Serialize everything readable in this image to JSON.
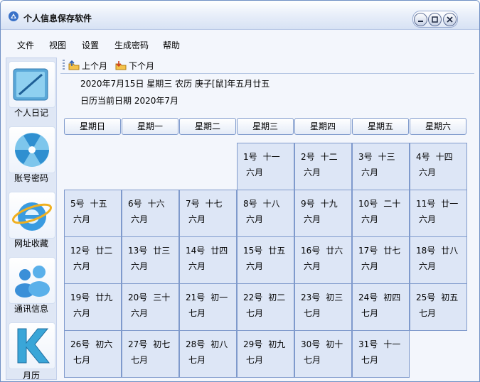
{
  "window": {
    "title": "个人信息保存软件"
  },
  "menu": [
    "文件",
    "视图",
    "设置",
    "生成密码",
    "帮助"
  ],
  "sidebar": [
    {
      "label": "个人日记",
      "icon": "diary-icon"
    },
    {
      "label": "账号密码",
      "icon": "account-password-icon"
    },
    {
      "label": "网址收藏",
      "icon": "ie-bookmark-icon"
    },
    {
      "label": "通讯信息",
      "icon": "contacts-icon"
    },
    {
      "label": "月历",
      "icon": "calendar-icon"
    }
  ],
  "toolbar": {
    "prev_label": "上个月",
    "next_label": "下个月"
  },
  "info": {
    "today": "2020年7月15日  星期三  农历  庚子[鼠]年五月廿五",
    "current": "日历当前日期  2020年7月"
  },
  "weekdays": [
    "星期日",
    "星期一",
    "星期二",
    "星期三",
    "星期四",
    "星期五",
    "星期六"
  ],
  "days": [
    {
      "day": "1号",
      "lunar": "十一",
      "month": "六月"
    },
    {
      "day": "2号",
      "lunar": "十二",
      "month": "六月"
    },
    {
      "day": "3号",
      "lunar": "十三",
      "month": "六月"
    },
    {
      "day": "4号",
      "lunar": "十四",
      "month": "六月"
    },
    {
      "day": "5号",
      "lunar": "十五",
      "month": "六月"
    },
    {
      "day": "6号",
      "lunar": "十六",
      "month": "六月"
    },
    {
      "day": "7号",
      "lunar": "十七",
      "month": "六月"
    },
    {
      "day": "8号",
      "lunar": "十八",
      "month": "六月"
    },
    {
      "day": "9号",
      "lunar": "十九",
      "month": "六月"
    },
    {
      "day": "10号",
      "lunar": "二十",
      "month": "六月"
    },
    {
      "day": "11号",
      "lunar": "廿一",
      "month": "六月"
    },
    {
      "day": "12号",
      "lunar": "廿二",
      "month": "六月"
    },
    {
      "day": "13号",
      "lunar": "廿三",
      "month": "六月"
    },
    {
      "day": "14号",
      "lunar": "廿四",
      "month": "六月"
    },
    {
      "day": "15号",
      "lunar": "廿五",
      "month": "六月"
    },
    {
      "day": "16号",
      "lunar": "廿六",
      "month": "六月"
    },
    {
      "day": "17号",
      "lunar": "廿七",
      "month": "六月"
    },
    {
      "day": "18号",
      "lunar": "廿八",
      "month": "六月"
    },
    {
      "day": "19号",
      "lunar": "廿九",
      "month": "六月"
    },
    {
      "day": "20号",
      "lunar": "三十",
      "month": "六月"
    },
    {
      "day": "21号",
      "lunar": "初一",
      "month": "七月"
    },
    {
      "day": "22号",
      "lunar": "初二",
      "month": "七月"
    },
    {
      "day": "23号",
      "lunar": "初三",
      "month": "七月"
    },
    {
      "day": "24号",
      "lunar": "初四",
      "month": "七月"
    },
    {
      "day": "25号",
      "lunar": "初五",
      "month": "七月"
    },
    {
      "day": "26号",
      "lunar": "初六",
      "month": "七月"
    },
    {
      "day": "27号",
      "lunar": "初七",
      "month": "七月"
    },
    {
      "day": "28号",
      "lunar": "初八",
      "month": "七月"
    },
    {
      "day": "29号",
      "lunar": "初九",
      "month": "七月"
    },
    {
      "day": "30号",
      "lunar": "初十",
      "month": "七月"
    },
    {
      "day": "31号",
      "lunar": "十一",
      "month": "七月"
    }
  ],
  "first_weekday_index": 3,
  "colors": {
    "accent": "#7f9acc",
    "cell": "#dde6f6",
    "frame": "#6f8fc4"
  }
}
